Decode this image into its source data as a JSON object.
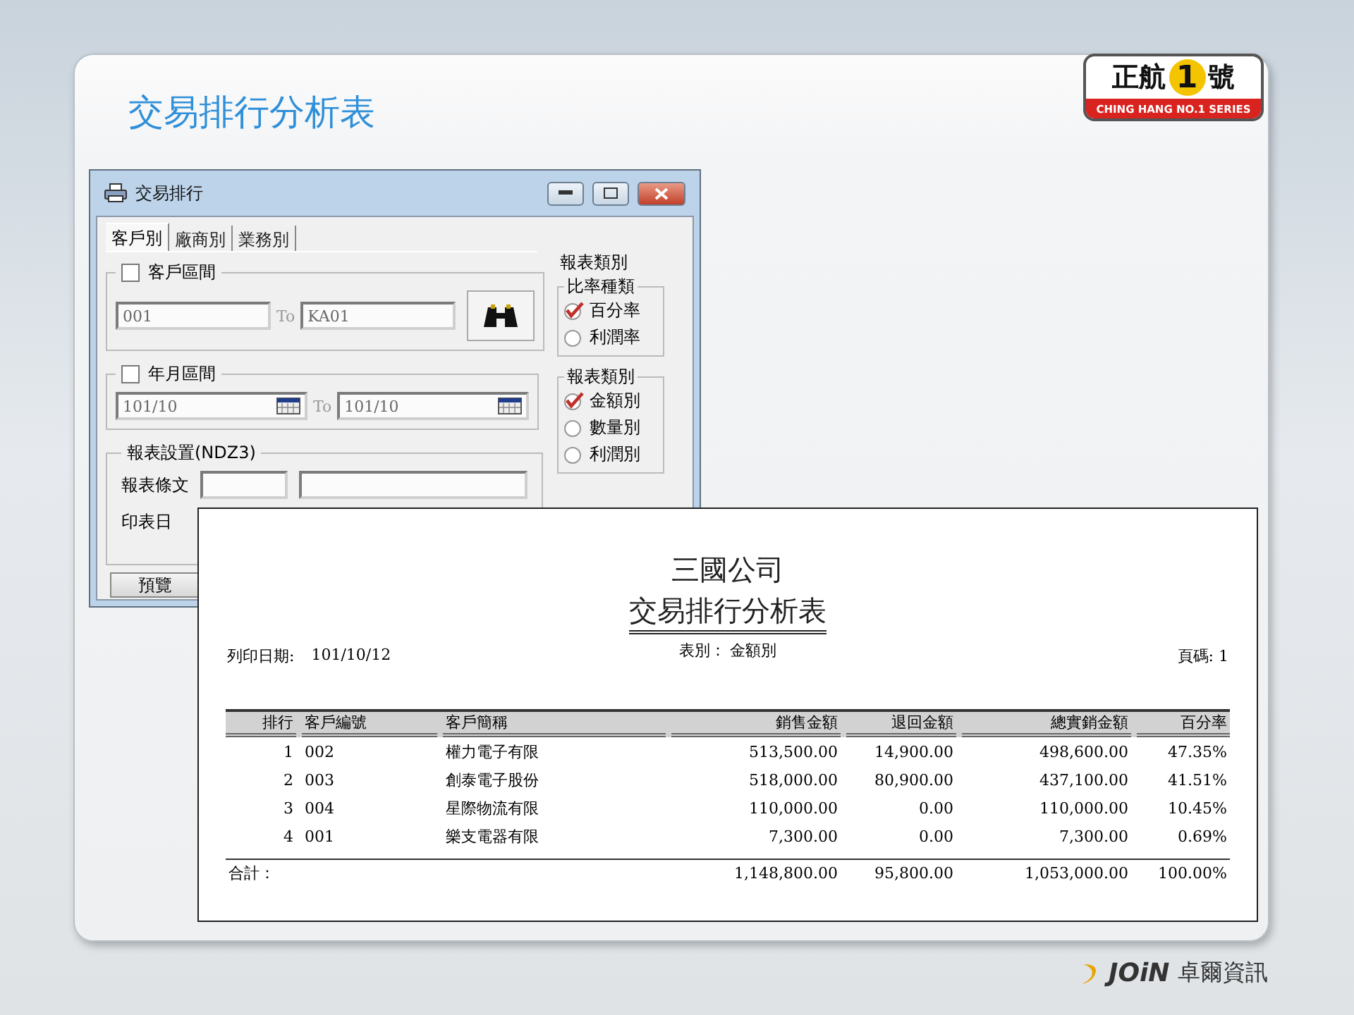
{
  "slide": {
    "title": "交易排行分析表"
  },
  "brand_logo": {
    "left": "正航",
    "number": "1",
    "right": "號",
    "tagline": "CHING HANG NO.1 SERIES"
  },
  "footer_logo": {
    "wordmark": "JOiN",
    "company": "卓爾資訊"
  },
  "dialog": {
    "title": "交易排行",
    "tabs": [
      {
        "label": "客戶別",
        "selected": true
      },
      {
        "label": "廠商別",
        "selected": false
      },
      {
        "label": "業務別",
        "selected": false
      }
    ],
    "customer_range": {
      "label": "客戶區間",
      "checked": false,
      "from": "001",
      "to_label": "To",
      "to": "KA01"
    },
    "month_range": {
      "label": "年月區間",
      "checked": false,
      "from": "101/10",
      "to_label": "To",
      "to": "101/10"
    },
    "report_settings": {
      "title": "報表設置(NDZ3)",
      "clause_label": "報表條文",
      "print_date_label": "印表日"
    },
    "report_category": {
      "title": "報表類別",
      "ratio_group": {
        "title": "比率種類",
        "options": [
          {
            "label": "百分率",
            "selected": true
          },
          {
            "label": "利潤率",
            "selected": false
          }
        ]
      },
      "type_group": {
        "title": "報表類別",
        "options": [
          {
            "label": "金額別",
            "selected": true
          },
          {
            "label": "數量別",
            "selected": false
          },
          {
            "label": "利潤別",
            "selected": false
          }
        ]
      }
    },
    "preview_button": "預覽"
  },
  "report": {
    "company": "三國公司",
    "title": "交易排行分析表",
    "print_date_label": "列印日期:",
    "print_date": "101/10/12",
    "category": "表別： 金額別",
    "page": "頁碼: 1",
    "columns": [
      "排行",
      "客戶編號",
      "客戶簡稱",
      "銷售金額",
      "退回金額",
      "總實銷金額",
      "百分率"
    ],
    "rows": [
      [
        "1",
        "002",
        "權力電子有限",
        "513,500.00",
        "14,900.00",
        "498,600.00",
        "47.35%"
      ],
      [
        "2",
        "003",
        "創泰電子股份",
        "518,000.00",
        "80,900.00",
        "437,100.00",
        "41.51%"
      ],
      [
        "3",
        "004",
        "星際物流有限",
        "110,000.00",
        "0.00",
        "110,000.00",
        "10.45%"
      ],
      [
        "4",
        "001",
        "樂支電器有限",
        "7,300.00",
        "0.00",
        "7,300.00",
        "0.69%"
      ]
    ],
    "total": [
      "合計：",
      "1,148,800.00",
      "95,800.00",
      "1,053,000.00",
      "100.00%"
    ]
  }
}
